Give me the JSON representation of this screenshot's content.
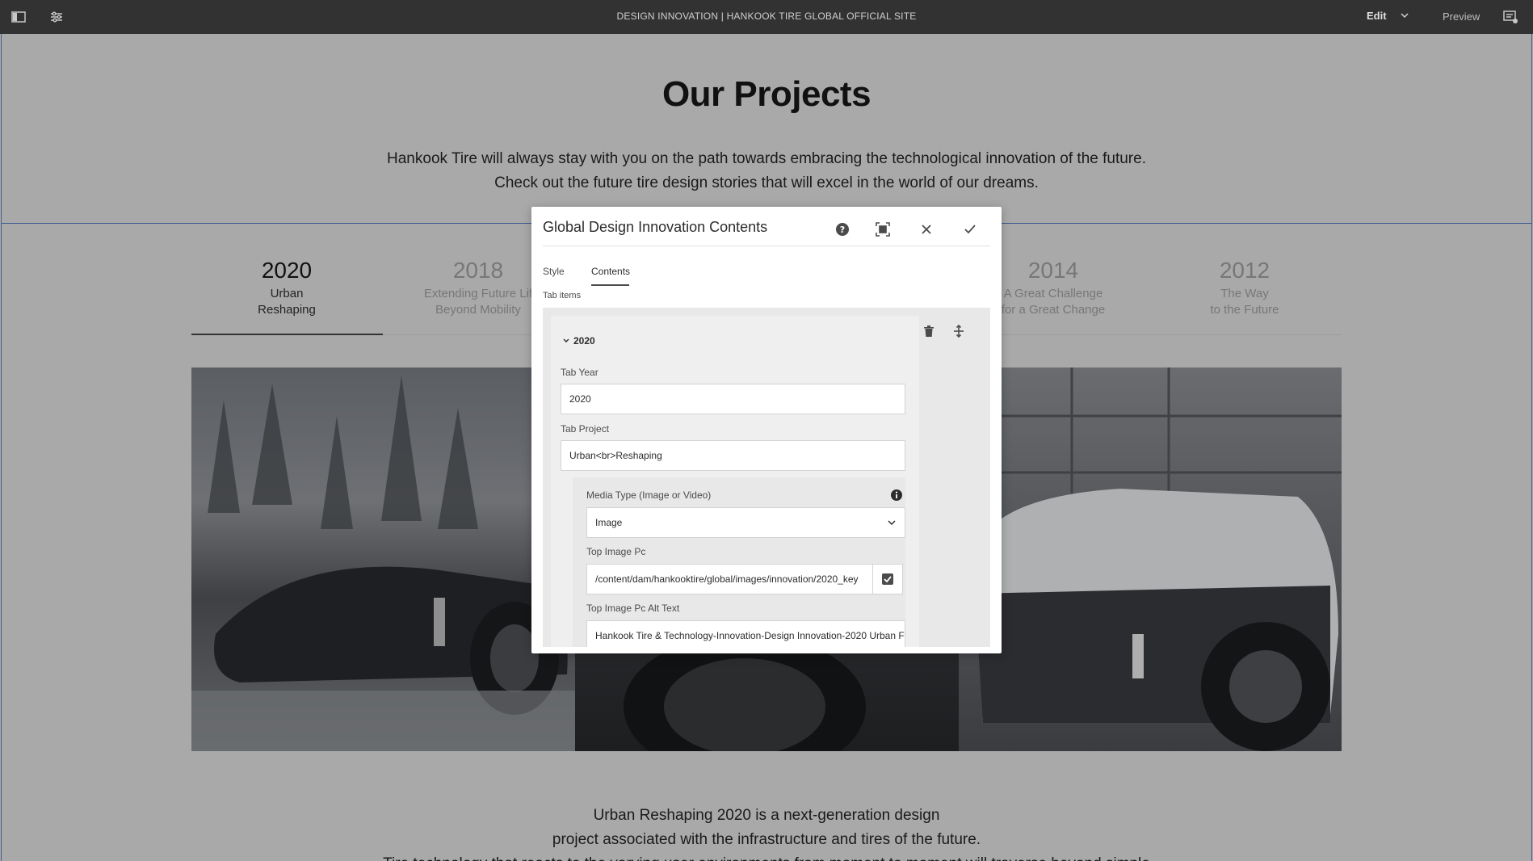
{
  "topbar": {
    "title": "DESIGN INNOVATION | HANKOOK TIRE GLOBAL OFFICIAL SITE",
    "mode_label": "Edit",
    "preview_label": "Preview"
  },
  "page": {
    "heading": "Our Projects",
    "intro_line1": "Hankook Tire will always stay with you on the path towards embracing the technological innovation of the future.",
    "intro_line2": "Check out the future tire design stories that will excel in the world of our dreams.",
    "tabs": [
      {
        "year": "2020",
        "label_line1": "Urban",
        "label_line2": "Reshaping"
      },
      {
        "year": "2018",
        "label_line1": "Extending Future Lif",
        "label_line2": "Beyond Mobility"
      },
      {
        "year": "2014",
        "label_line1": "A Great Challenge",
        "label_line2": "for a Great Change"
      },
      {
        "year": "2012",
        "label_line1": "The Way",
        "label_line2": "to the Future"
      }
    ],
    "description_line1": "Urban Reshaping 2020 is a next-generation design",
    "description_line2": "project associated with the infrastructure and tires of the future.",
    "description_line3": "Tire technology that reacts to the varying user environments from moment to moment will traverse beyond simple"
  },
  "dialog": {
    "title": "Global Design Innovation Contents",
    "tabs": [
      "Style",
      "Contents"
    ],
    "active_tab": "Contents",
    "tab_items_label": "Tab items",
    "item_heading": "2020",
    "fields": {
      "tab_year_label": "Tab Year",
      "tab_year_value": "2020",
      "tab_project_label": "Tab Project",
      "tab_project_value": "Urban<br>Reshaping",
      "media_type_label": "Media Type (Image or Video)",
      "media_type_value": "Image",
      "top_image_pc_label": "Top Image Pc",
      "top_image_pc_value": "/content/dam/hankooktire/global/images/innovation/2020_key",
      "top_image_alt_label": "Top Image Pc Alt Text",
      "top_image_alt_value": "Hankook Tire & Technology-Innovation-Design Innovation-2020 Urban F"
    }
  },
  "icons": {
    "sidebar_toggle": "sidebar-icon",
    "properties": "sliders-icon",
    "annotations": "annotation-icon",
    "help": "help-icon",
    "fullscreen": "fullscreen-icon",
    "close": "close-icon",
    "confirm": "check-icon",
    "delete": "trash-icon",
    "reorder": "move-icon",
    "info": "info-icon"
  }
}
